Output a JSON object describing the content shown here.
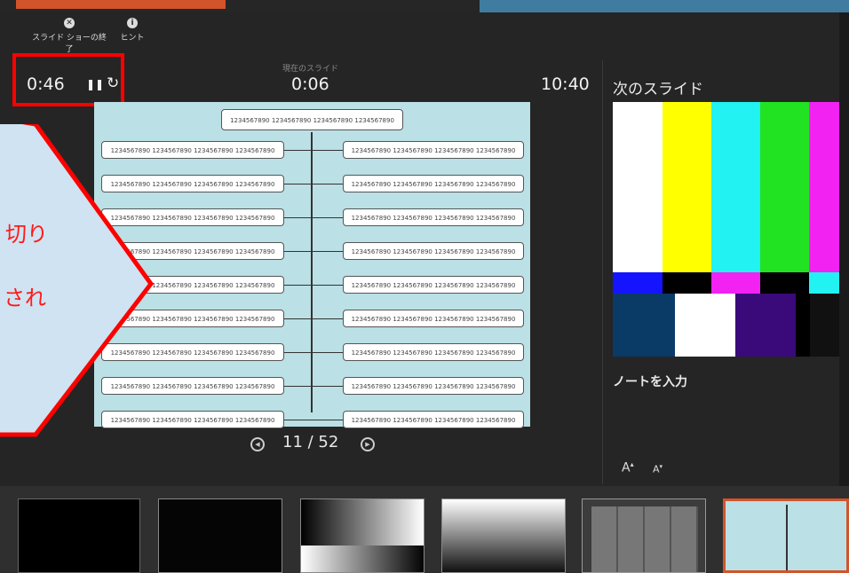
{
  "toolbar": {
    "end_show_label": "スライド ショーの終了",
    "hint_label": "ヒント"
  },
  "timers": {
    "elapsed": "0:46",
    "current_slide_label": "現在のスライド",
    "current_slide_time": "0:06",
    "clock": "10:40"
  },
  "next_slide": {
    "title": "次のスライド"
  },
  "notes": {
    "placeholder": "ノートを入力"
  },
  "font_controls": {
    "increase": "A",
    "decrease": "A"
  },
  "navigation": {
    "slide_counter": "11 / 52"
  },
  "callout": {
    "line1": "切り",
    "line2": "され"
  },
  "slide": {
    "top_box": "1234567890 1234567890 1234567890 1234567890",
    "left_boxes": [
      "1234567890 1234567890 1234567890 1234567890",
      "1234567890 1234567890 1234567890 1234567890",
      "1234567890 1234567890 1234567890 1234567890",
      "1234567890 1234567890 1234567890 1234567890",
      "1234567890 1234567890 1234567890 1234567890",
      "1234567890 1234567890 1234567890 1234567890",
      "1234567890 1234567890 1234567890 1234567890",
      "1234567890 1234567890 1234567890 1234567890",
      "1234567890 1234567890 1234567890 1234567890"
    ],
    "right_boxes": [
      "1234567890 1234567890 1234567890 1234567890",
      "1234567890 1234567890 1234567890 1234567890",
      "1234567890 1234567890 1234567890 1234567890",
      "1234567890 1234567890 1234567890 1234567890",
      "1234567890 1234567890 1234567890 1234567890",
      "1234567890 1234567890 1234567890 1234567890",
      "1234567890 1234567890 1234567890 1234567890",
      "1234567890 1234567890 1234567890 1234567890",
      "1234567890 1234567890 1234567890 1234567890"
    ]
  },
  "colors": {
    "accent": "#d2542a",
    "highlight": "#ff0000",
    "callout_fill": "#cfe3f2",
    "slide_bg": "#bbe0e5"
  }
}
